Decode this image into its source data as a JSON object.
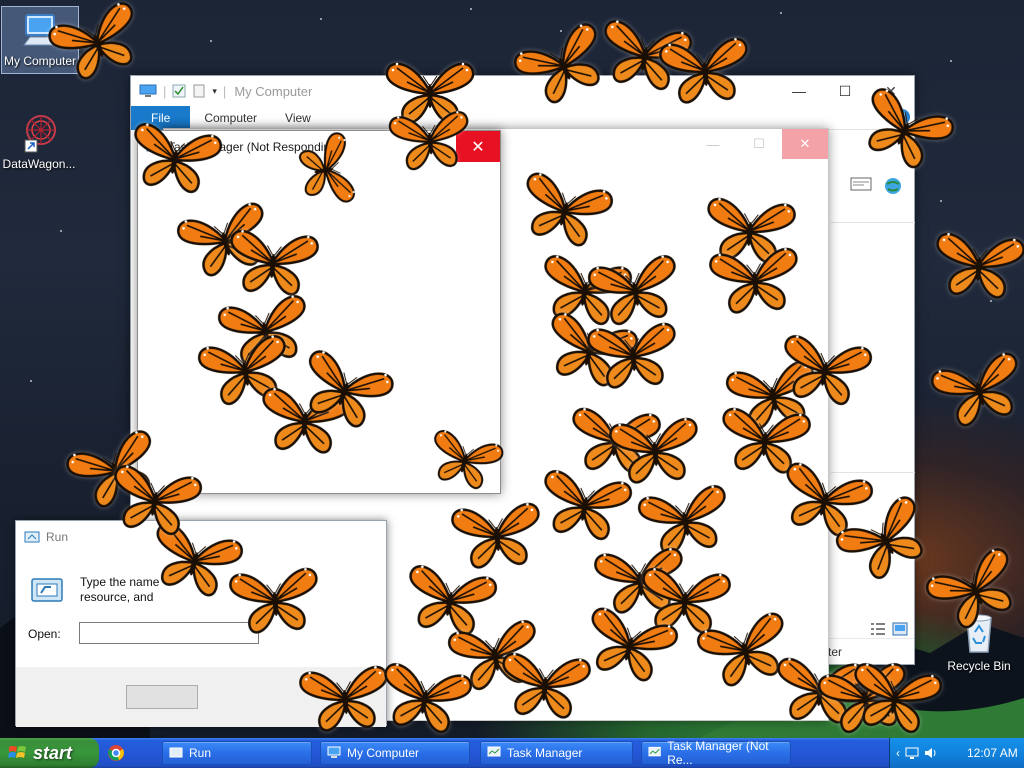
{
  "desktop": {
    "icons": [
      {
        "label": "My Computer",
        "icon": "computer-icon"
      },
      {
        "label": "DataWagon...",
        "icon": "datawagon-icon"
      },
      {
        "label": "Recycle Bin",
        "icon": "recycle-bin-icon"
      }
    ]
  },
  "explorer": {
    "title": "My Computer",
    "tabs": [
      "File",
      "Computer",
      "View"
    ],
    "status_text": "ter"
  },
  "task_manager_small": {
    "title": "Task Manager (Not Responding)"
  },
  "run_dialog": {
    "title": "Run",
    "body_line1": "Type the name",
    "body_line2": "resource, and",
    "open_label": "Open:",
    "open_value": ""
  },
  "taskbar": {
    "start_label": "start",
    "buttons": [
      {
        "label": "Run",
        "icon": "run-icon"
      },
      {
        "label": "My Computer",
        "icon": "computer-icon"
      },
      {
        "label": "Task Manager",
        "icon": "task-manager-icon"
      },
      {
        "label": "Task Manager (Not Re...",
        "icon": "task-manager-icon"
      }
    ],
    "clock": "12:07 AM"
  },
  "colors": {
    "butterfly_orange": "#f07c12",
    "butterfly_vein": "#1a0f05",
    "xp_taskbar": "#245edc",
    "xp_start": "#37963a",
    "close_red": "#e81123",
    "file_tab": "#1979ca"
  }
}
